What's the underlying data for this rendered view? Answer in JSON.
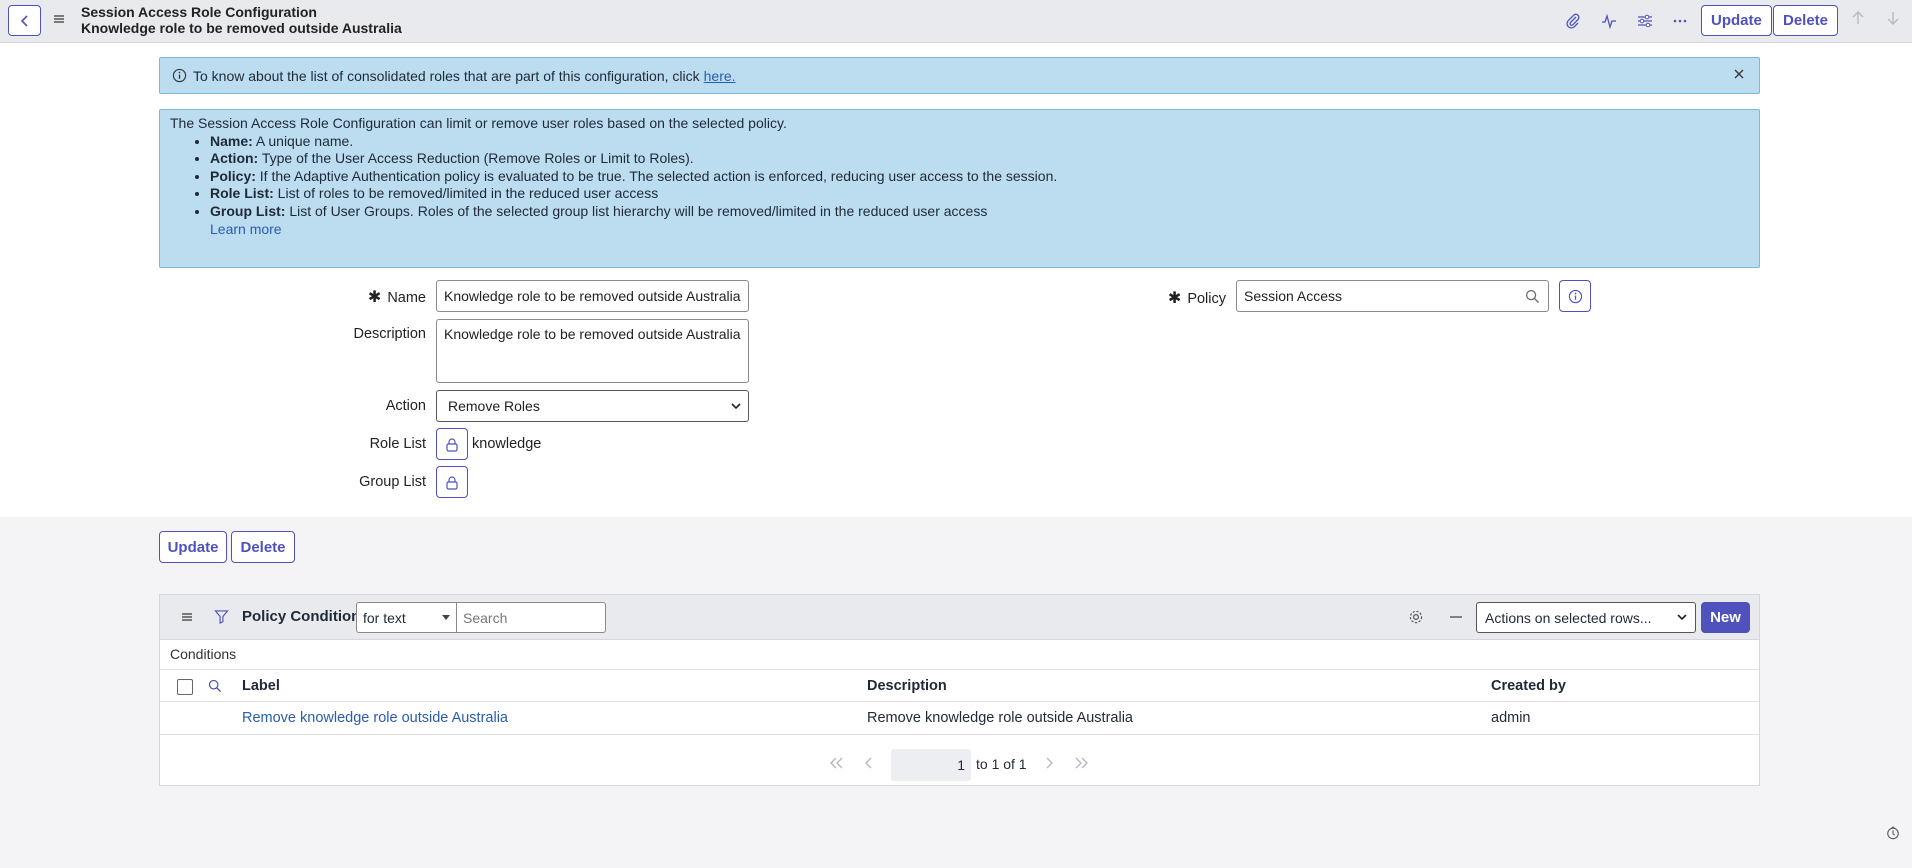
{
  "header": {
    "title": "Session Access Role Configuration",
    "subtitle": "Knowledge role to be removed outside Australia",
    "update_label": "Update",
    "delete_label": "Delete"
  },
  "info_banner": {
    "text": "To know about the list of consolidated roles that are part of this configuration, click",
    "link": "here."
  },
  "help": {
    "intro": "The Session Access Role Configuration can limit or remove user roles based on the selected policy.",
    "items": [
      {
        "term": "Name:",
        "desc": "A unique name."
      },
      {
        "term": "Action:",
        "desc": "Type of the User Access Reduction (Remove Roles or Limit to Roles)."
      },
      {
        "term": "Policy:",
        "desc": "If the Adaptive Authentication policy is evaluated to be true. The selected action is enforced, reducing user access to the session."
      },
      {
        "term": "Role List:",
        "desc": "List of roles to be removed/limited in the reduced user access"
      },
      {
        "term": "Group List:",
        "desc": "List of User Groups. Roles of the selected group list hierarchy will be removed/limited in the reduced user access"
      }
    ],
    "learn_more": "Learn more"
  },
  "form": {
    "name_label": "Name",
    "name_value": "Knowledge role to be removed outside Australia",
    "description_label": "Description",
    "description_value": "Knowledge role to be removed outside Australia",
    "action_label": "Action",
    "action_value": "Remove Roles",
    "role_list_label": "Role List",
    "role_list_value": "knowledge",
    "group_list_label": "Group List",
    "policy_label": "Policy",
    "policy_value": "Session Access",
    "required_mark": "✱"
  },
  "bottom": {
    "update_label": "Update",
    "delete_label": "Delete"
  },
  "related_list": {
    "title": "Policy Conditions",
    "for_text": "for text",
    "search_placeholder": "Search",
    "actions_select": "Actions on selected rows...",
    "new_label": "New",
    "breadcrumb": "Conditions",
    "columns": [
      "Label",
      "Description",
      "Created by"
    ],
    "rows": [
      {
        "label": "Remove knowledge role outside Australia",
        "description": "Remove knowledge role outside Australia",
        "created_by": "admin"
      }
    ],
    "pager": {
      "page": "1",
      "text": "to 1 of 1"
    }
  },
  "colors": {
    "accent": "#4f52bd",
    "banner": "#bcdcf0",
    "link": "#2a5db0"
  }
}
